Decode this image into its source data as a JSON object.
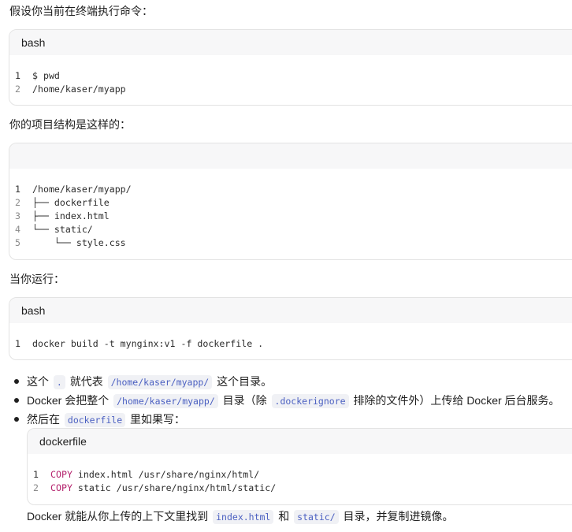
{
  "intro1": "假设你当前在终端执行命令：",
  "block1": {
    "lang": "bash",
    "lines": [
      {
        "num": "1",
        "text": "$ pwd"
      },
      {
        "num": "2",
        "text": "/home/kaser/myapp"
      }
    ]
  },
  "intro2": "你的项目结构是这样的：",
  "block2": {
    "lang": "",
    "lines": [
      {
        "num": "1",
        "text": "/home/kaser/myapp/"
      },
      {
        "num": "2",
        "text": "├── dockerfile"
      },
      {
        "num": "3",
        "text": "├── index.html"
      },
      {
        "num": "4",
        "text": "└── static/"
      },
      {
        "num": "5",
        "text": "    └── style.css"
      }
    ]
  },
  "intro3": "当你运行：",
  "block3": {
    "lang": "bash",
    "lines": [
      {
        "num": "1",
        "text": "docker build -t mynginx:v1 -f dockerfile ."
      }
    ]
  },
  "bullets": [
    {
      "pre": "这个",
      "code1": ".",
      "mid": "就代表",
      "code2": "/home/kaser/myapp/",
      "post": "这个目录。"
    },
    {
      "pre": "Docker 会把整个",
      "code1": "/home/kaser/myapp/",
      "mid": "目录（除",
      "code2": ".dockerignore",
      "post": "排除的文件外）上传给 Docker 后台服务。"
    },
    {
      "pre": "然后在",
      "code1": "dockerfile",
      "post": "里如果写："
    }
  ],
  "block4": {
    "lang": "dockerfile",
    "lines": [
      {
        "num": "1",
        "kw": "COPY",
        "text": " index.html /usr/share/nginx/html/"
      },
      {
        "num": "2",
        "kw": "COPY",
        "text": " static /usr/share/nginx/html/static/"
      }
    ]
  },
  "outro": {
    "pre": "Docker 就能从你上传的上下文里找到",
    "code1": "index.html",
    "mid": "和",
    "code2": "static/",
    "post": "目录，并复制进镜像。"
  },
  "colors": {
    "inline_code": "#4a5fc1",
    "keyword": "#b5246e",
    "header_bg": "#f7f7f8",
    "border": "#e3e3e3"
  }
}
